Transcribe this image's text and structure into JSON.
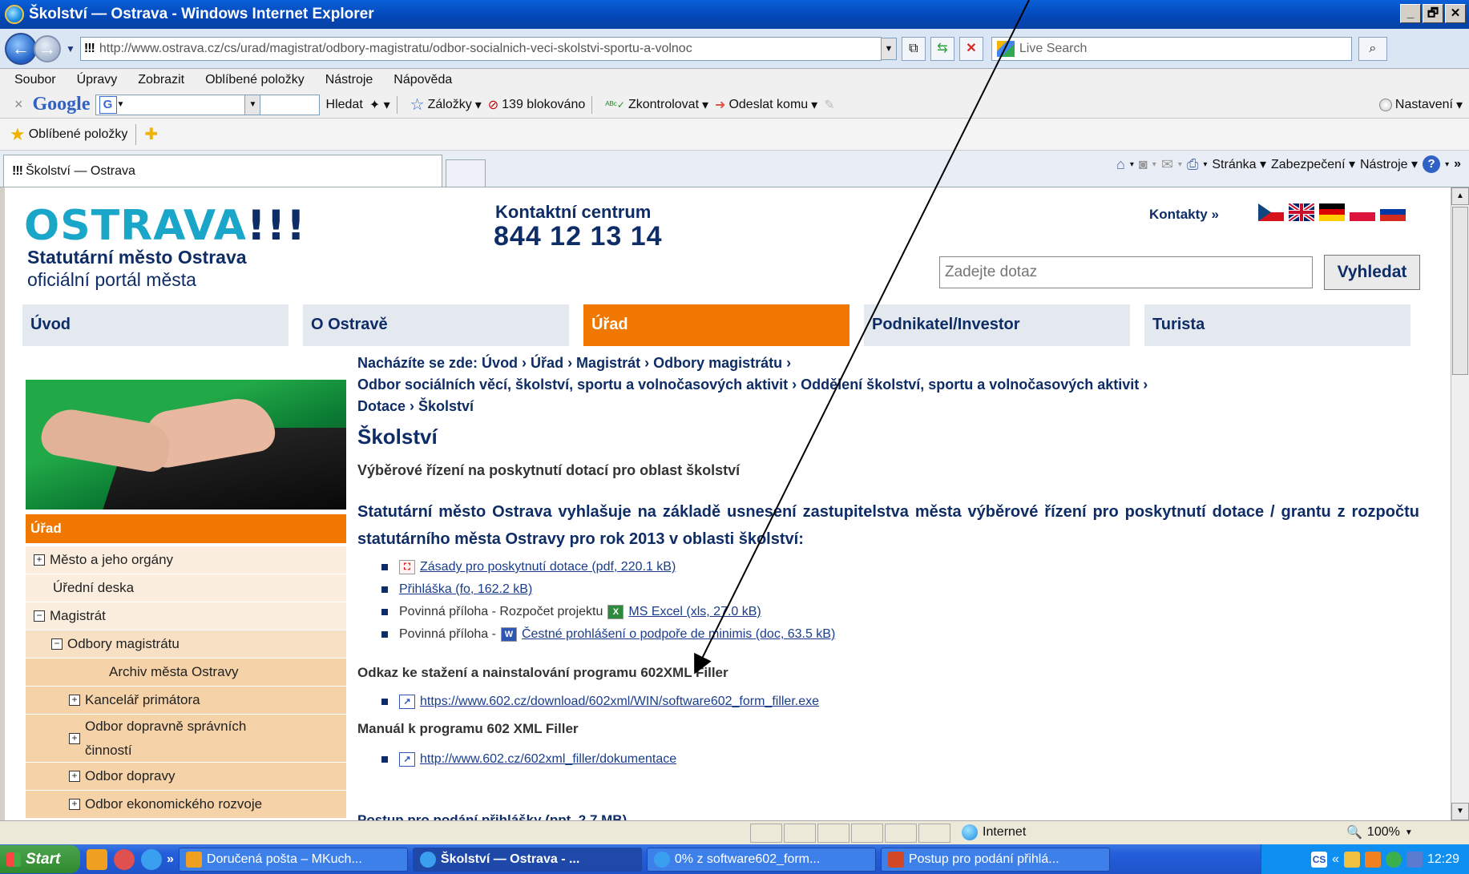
{
  "window": {
    "title": "Školství — Ostrava - Windows Internet Explorer",
    "controls": [
      "_",
      "🗗",
      "✕"
    ]
  },
  "address_bar": {
    "site_icon": "!!!",
    "url": "http://www.ostrava.cz/cs/urad/magistrat/odbory-magistratu/odbor-socialnich-veci-skolstvi-sportu-a-volnoc",
    "search_placeholder": "Live Search"
  },
  "menu": [
    "Soubor",
    "Úpravy",
    "Zobrazit",
    "Oblíbené položky",
    "Nástroje",
    "Nápověda"
  ],
  "google_toolbar": {
    "logo": "Google",
    "search_btn": "Hledat",
    "bookmarks": "Záložky",
    "blocked": "139 blokováno",
    "spellcheck": "Zkontrolovat",
    "send_to": "Odeslat komu",
    "settings": "Nastavení"
  },
  "favorites_bar": {
    "label": "Oblíbené položky"
  },
  "tab": {
    "site_icon": "!!!",
    "title": "Školství — Ostrava"
  },
  "command_bar": {
    "page": "Stránka",
    "security": "Zabezpečení",
    "tools": "Nástroje"
  },
  "site": {
    "logo_text": "OSTRAVA",
    "logo_bangs": "!!!",
    "city": "Statutární město Ostrava",
    "portal": "oficiální portál města",
    "contact_label": "Kontaktní centrum",
    "contact_phone": "844 12 13 14",
    "contacts_link": "Kontakty »",
    "search_placeholder": "Zadejte dotaz",
    "search_button": "Vyhledat",
    "nav": [
      "Úvod",
      "O Ostravě",
      "Úřad",
      "Podnikatel/Investor",
      "Turista"
    ],
    "nav_active_index": 2
  },
  "sidebar": {
    "heading": "Úřad",
    "items": [
      {
        "label": "Město a jeho orgány",
        "expander": "+"
      },
      {
        "label": "Úřední deska",
        "expander": ""
      },
      {
        "label": "Magistrát",
        "expander": "−"
      },
      {
        "label": "Odbory magistrátu",
        "expander": "−"
      },
      {
        "label": "Archiv města Ostravy",
        "expander": ""
      },
      {
        "label": "Kancelář primátora",
        "expander": "+"
      },
      {
        "label": "Odbor dopravně správních činností",
        "expander": "+"
      },
      {
        "label": "Odbor dopravy",
        "expander": "+"
      },
      {
        "label": "Odbor ekonomického rozvoje",
        "expander": "+"
      }
    ]
  },
  "content": {
    "breadcrumb_line1": "Nacházíte se zde: Úvod › Úřad › Magistrát › Odbory magistrátu ›",
    "breadcrumb_line2": "Odbor sociálních věcí, školství, sportu a volnočasových aktivit › Oddělení školství, sportu a volnočasových aktivit ›",
    "breadcrumb_line3": "Dotace › Školství",
    "title": "Školství",
    "subheading": "Výběrové řízení na poskytnutí dotací pro oblast školství",
    "intro": "Statutární město Ostrava vyhlašuje na základě usnesení zastupitelstva města výběrové řízení pro poskytnutí dotace / grantu z rozpočtu statutárního města Ostravy pro rok 2013 v oblasti školství:",
    "documents": [
      {
        "prefix": "",
        "icon": "pdf",
        "link": "Zásady pro poskytnutí dotace (pdf, 220.1 kB)"
      },
      {
        "prefix": "",
        "icon": "",
        "link": "Přihláška (fo, 162.2 kB)"
      },
      {
        "prefix": "Povinná příloha - Rozpočet projektu",
        "icon": "xls",
        "link": "MS Excel (xls, 27.0 kB)"
      },
      {
        "prefix": "Povinná příloha -",
        "icon": "doc",
        "link": "Čestné prohlášení o podpoře de minimis (doc, 63.5 kB)"
      }
    ],
    "download_heading": "Odkaz ke stažení a nainstalování programu 602XML Filler",
    "download_link": "https://www.602.cz/download/602xml/WIN/software602_form_filler.exe",
    "manual_heading": "Manuál k programu 602 XML Filler",
    "manual_link": "http://www.602.cz/602xml_filler/dokumentace",
    "cut_off": "Postup pro podání přihlášky (ppt, 2.7 MB)"
  },
  "statusbar": {
    "zone": "Internet",
    "zoom": "100%"
  },
  "taskbar": {
    "start": "Start",
    "buttons": [
      "Doručená pošta – MKuch...",
      "Školství — Ostrava - ...",
      "0% z software602_form...",
      "Postup pro podání přihlá..."
    ],
    "clock": "12:29"
  }
}
